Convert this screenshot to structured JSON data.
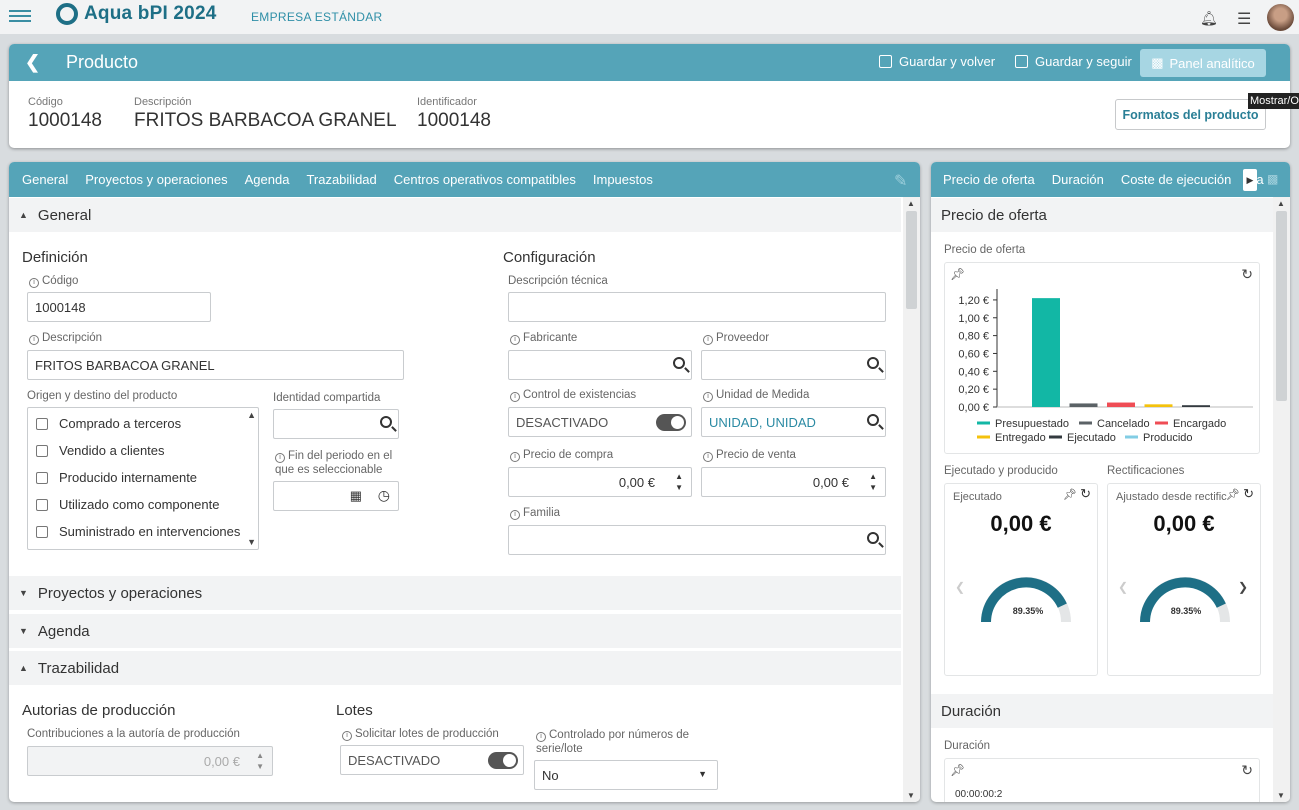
{
  "app": {
    "name": "Aqua bPI 2024",
    "company": "EMPRESA ESTÁNDAR"
  },
  "header": {
    "title": "Producto",
    "save_back": "Guardar y volver",
    "save_continue": "Guardar y seguir",
    "analytics": "Panel analítico",
    "formats": "Formatos del producto",
    "tooltip": "Mostrar/Ocultar",
    "fields": [
      {
        "label": "Código",
        "value": "1000148"
      },
      {
        "label": "Descripción",
        "value": "FRITOS BARBACOA GRANEL"
      },
      {
        "label": "Identificador",
        "value": "1000148"
      }
    ]
  },
  "tabs": [
    "General",
    "Proyectos y operaciones",
    "Agenda",
    "Trazabilidad",
    "Centros operativos compatibles",
    "Impuestos"
  ],
  "general": {
    "section": "General",
    "definicion": "Definición",
    "codigo_label": "Código",
    "codigo": "1000148",
    "descripcion_label": "Descripción",
    "descripcion": "FRITOS BARBACOA GRANEL",
    "origen_label": "Origen y destino del producto",
    "origen_items": [
      "Comprado a terceros",
      "Vendido a clientes",
      "Producido internamente",
      "Utilizado como componente",
      "Suministrado en intervenciones"
    ],
    "identidad_label": "Identidad compartida",
    "fin_label": "Fin del periodo en el que es seleccionable",
    "configuracion": "Configuración",
    "desc_tecnica_label": "Descripción técnica",
    "fabricante_label": "Fabricante",
    "proveedor_label": "Proveedor",
    "control_label": "Control de existencias",
    "control_value": "DESACTIVADO",
    "unidad_label": "Unidad de Medida",
    "unidad_value": "UNIDAD, UNIDAD",
    "precio_compra_label": "Precio de compra",
    "precio_compra": "0,00 €",
    "precio_venta_label": "Precio de venta",
    "precio_venta": "0,00 €",
    "familia_label": "Familia"
  },
  "sections": {
    "proyectos": "Proyectos y operaciones",
    "agenda": "Agenda",
    "trazabilidad": "Trazabilidad"
  },
  "trazabilidad": {
    "autorias": "Autorias de producción",
    "contrib_label": "Contribuciones a la autoría de producción",
    "contrib_value": "0,00 €",
    "lotes": "Lotes",
    "solicitar_label": "Solicitar lotes de producción",
    "solicitar_value": "DESACTIVADO",
    "controlado_label": "Controlado por números de serie/lote",
    "controlado_value": "No"
  },
  "right": {
    "tabs": [
      "Precio de oferta",
      "Duración",
      "Coste de ejecución",
      "Fa"
    ],
    "section": "Precio de oferta",
    "chart_label": "Precio de oferta",
    "ejecutado_title": "Ejecutado y producido",
    "rect_title": "Rectificaciones",
    "card1_label": "Ejecutado",
    "card1_value": "0,00 €",
    "card1_pct": "89.35%",
    "card2_label": "Ajustado desde rectific...",
    "card2_value": "0,00 €",
    "card2_pct": "89.35%",
    "duracion_section": "Duración",
    "duracion_label": "Duración",
    "duracion_value": "00:00:00:2"
  },
  "chart_data": {
    "type": "bar",
    "categories": [
      "Presupuestado",
      "Cancelado",
      "Encargado",
      "Entregado",
      "Ejecutado",
      "Producido"
    ],
    "values": [
      1.22,
      0.04,
      0.05,
      0.03,
      0.02,
      0.0
    ],
    "colors": [
      "#12b7a5",
      "#5b6266",
      "#ef4d55",
      "#f4c20d",
      "#333a3f",
      "#82cde4"
    ],
    "ylim": [
      0,
      1.3
    ],
    "yticks": [
      "0,00 €",
      "0,20 €",
      "0,40 €",
      "0,60 €",
      "0,80 €",
      "1,00 €",
      "1,20 €"
    ],
    "ytick_values": [
      0,
      0.2,
      0.4,
      0.6,
      0.8,
      1.0,
      1.2
    ],
    "legend_position": "bottom"
  }
}
